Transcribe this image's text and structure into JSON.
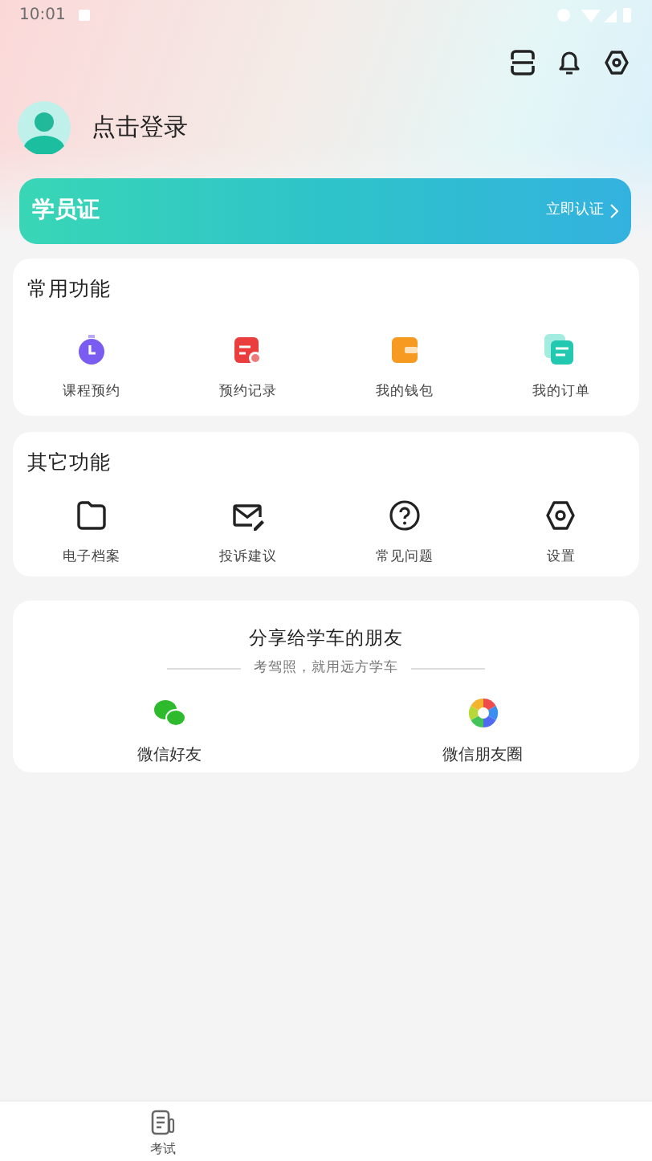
{
  "status_bar": {
    "time": "10:01"
  },
  "profile": {
    "login_text": "点击登录"
  },
  "student_card": {
    "title": "学员证",
    "action": "立即认证"
  },
  "common_functions": {
    "title": "常用功能",
    "items": [
      {
        "label": "课程预约"
      },
      {
        "label": "预约记录"
      },
      {
        "label": "我的钱包"
      },
      {
        "label": "我的订单"
      }
    ]
  },
  "other_functions": {
    "title": "其它功能",
    "items": [
      {
        "label": "电子档案"
      },
      {
        "label": "投诉建议"
      },
      {
        "label": "常见问题"
      },
      {
        "label": "设置"
      }
    ]
  },
  "share": {
    "title": "分享给学车的朋友",
    "subtitle": "考驾照，就用远方学车",
    "targets": [
      {
        "label": "微信好友"
      },
      {
        "label": "微信朋友圈"
      }
    ]
  },
  "bottom_nav": [
    {
      "label": "考试"
    }
  ]
}
